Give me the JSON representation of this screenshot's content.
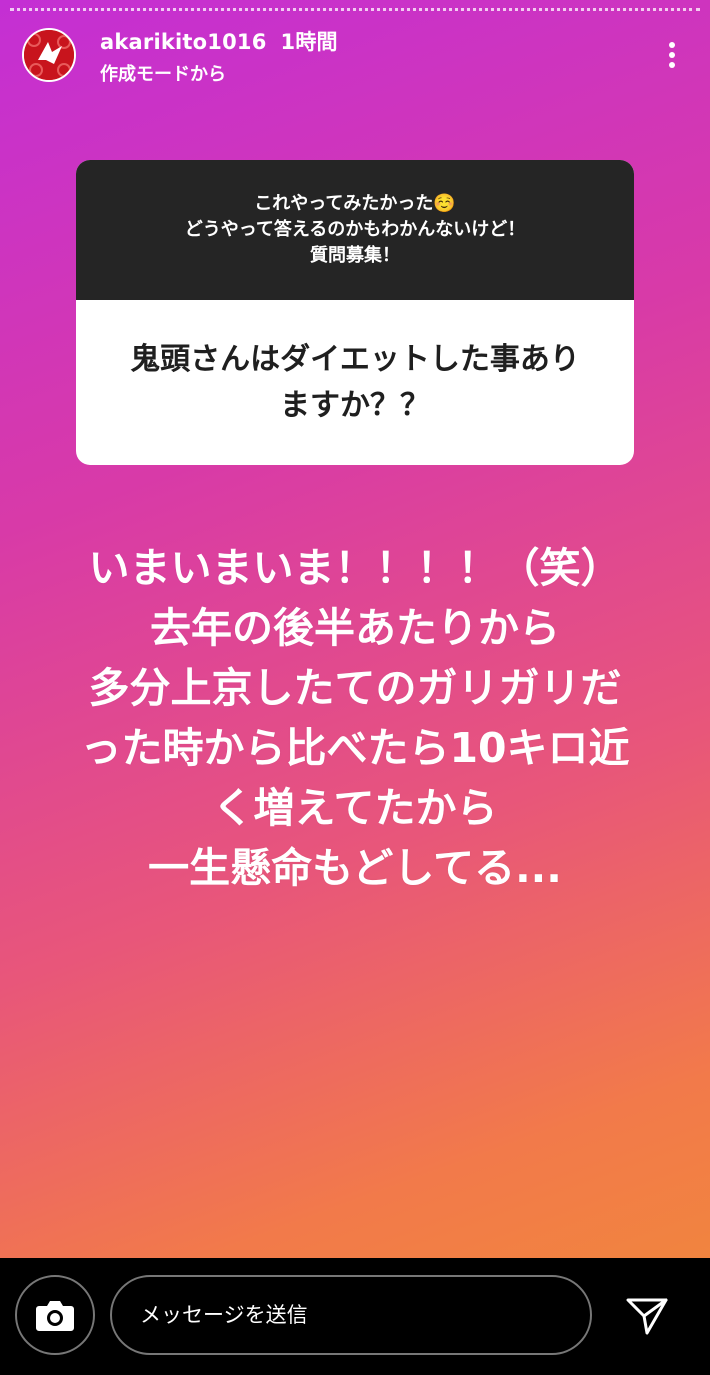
{
  "header": {
    "username": "akarikito1016",
    "time": "1時間",
    "subtitle": "作成モードから",
    "more_icon": "more-vertical-icon"
  },
  "question_sticker": {
    "prompt_lines": [
      "これやってみたかった☺️",
      "どうやって答えるのかもわかんないけど！",
      "質問募集！"
    ],
    "question_lines": [
      "鬼頭さんはダイエットした事あり",
      "ますか？？"
    ]
  },
  "answer_lines": [
    "いまいまいま！！！！（笑）",
    "去年の後半あたりから",
    "多分上京したてのガリガリだ",
    "った時から比べたら10キロ近",
    "く増えてたから",
    "一生懸命もどしてる..."
  ],
  "footer": {
    "camera_icon": "camera-icon",
    "message_placeholder": "メッセージを送信",
    "send_icon": "send-icon"
  },
  "colors": {
    "gradient": [
      "#c42fd4",
      "#d83aa8",
      "#e8567a",
      "#f27a4a",
      "#f1843f"
    ],
    "sticker_header": "#252525",
    "sticker_body": "#ffffff"
  }
}
